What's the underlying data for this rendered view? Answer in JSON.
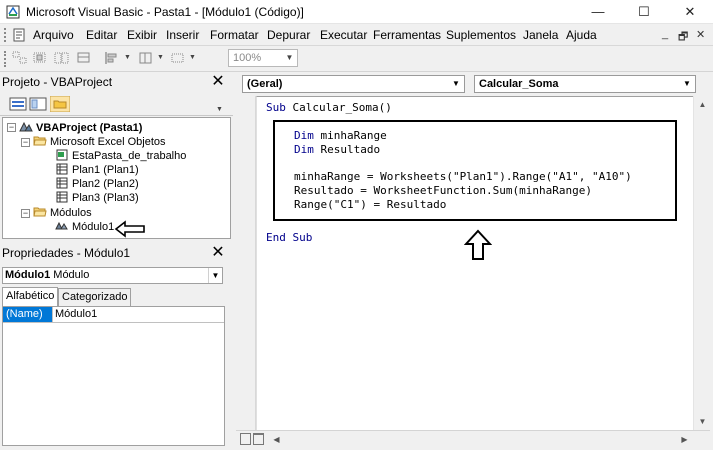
{
  "window": {
    "title": "Microsoft Visual Basic - Pasta1 - [Módulo1 (Código)]",
    "controls": [
      "—",
      "☐",
      "✕"
    ]
  },
  "menu": {
    "items": [
      "Arquivo",
      "Editar",
      "Exibir",
      "Inserir",
      "Formatar",
      "Depurar",
      "Executar",
      "Ferramentas",
      "Suplementos",
      "Janela",
      "Ajuda"
    ],
    "mdi_controls": [
      "_",
      "🗗",
      "✕"
    ]
  },
  "toolbar": {
    "zoom_value": "100%"
  },
  "project_panel": {
    "title": "Projeto - VBAProject",
    "tree": {
      "root": "VBAProject (Pasta1)",
      "excel_folder": "Microsoft Excel Objetos",
      "workbook": "EstaPasta_de_trabalho",
      "sheets": [
        "Plan1 (Plan1)",
        "Plan2 (Plan2)",
        "Plan3 (Plan3)"
      ],
      "modules_folder": "Módulos",
      "module": "Módulo1"
    }
  },
  "properties_panel": {
    "title": "Propriedades - Módulo1",
    "object_name": "Módulo1",
    "object_type": "Módulo",
    "tabs": [
      "Alfabético",
      "Categorizado"
    ],
    "rows": [
      {
        "name": "(Name)",
        "value": "Módulo1"
      }
    ]
  },
  "code_window": {
    "object_combo": "(Geral)",
    "procedure_combo": "Calcular_Soma",
    "lines": [
      {
        "kw": "Sub",
        "rest": " Calcular_Soma()"
      },
      {
        "kw": "Dim",
        "rest": " minhaRange"
      },
      {
        "kw": "Dim",
        "rest": " Resultado"
      },
      {
        "kw": "",
        "rest": "minhaRange = Worksheets(\"Plan1\").Range(\"A1\", \"A10\")"
      },
      {
        "kw": "",
        "rest": "Resultado = WorksheetFunction.Sum(minhaRange)"
      },
      {
        "kw": "",
        "rest": "Range(\"C1\") = Resultado"
      },
      {
        "kw": "End Sub",
        "rest": ""
      }
    ]
  },
  "annotations": {
    "module_arrow": "left-arrow",
    "code_arrow": "up-arrow"
  }
}
